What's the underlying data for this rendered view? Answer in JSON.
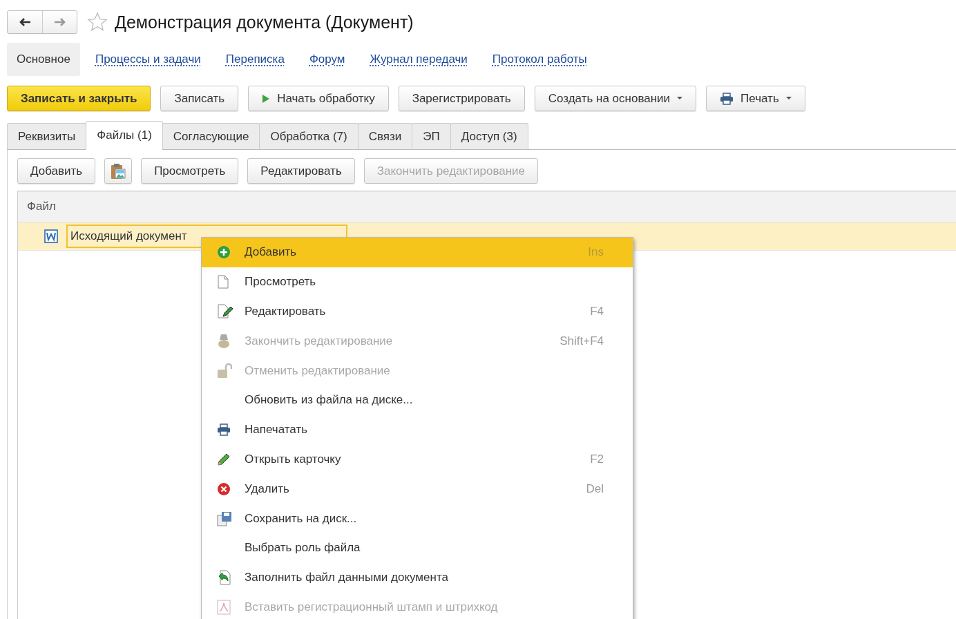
{
  "window": {
    "title": "Демонстрация документа (Документ)"
  },
  "nav_links": [
    {
      "label": "Основное",
      "selected": true
    },
    {
      "label": "Процессы и задачи",
      "selected": false
    },
    {
      "label": "Переписка",
      "selected": false
    },
    {
      "label": "Форум",
      "selected": false
    },
    {
      "label": "Журнал передачи",
      "selected": false
    },
    {
      "label": "Протокол работы",
      "selected": false
    }
  ],
  "commands": [
    {
      "label": "Записать и закрыть",
      "kind": "primary"
    },
    {
      "label": "Записать",
      "kind": "plain"
    },
    {
      "label": "Начать обработку",
      "kind": "play"
    },
    {
      "label": "Зарегистрировать",
      "kind": "plain"
    },
    {
      "label": "Создать на основании",
      "kind": "dropdown"
    },
    {
      "label": "Печать",
      "kind": "print"
    }
  ],
  "tabs": [
    {
      "label": "Реквизиты",
      "selected": false
    },
    {
      "label": "Файлы (1)",
      "selected": true
    },
    {
      "label": "Согласующие",
      "selected": false
    },
    {
      "label": "Обработка (7)",
      "selected": false
    },
    {
      "label": "Связи",
      "selected": false
    },
    {
      "label": "ЭП",
      "selected": false
    },
    {
      "label": "Доступ (3)",
      "selected": false
    }
  ],
  "files_toolbar": [
    {
      "label": "Добавить",
      "kind": "text",
      "disabled": false
    },
    {
      "kind": "paste",
      "disabled": false
    },
    {
      "label": "Просмотреть",
      "kind": "text",
      "disabled": false
    },
    {
      "label": "Редактировать",
      "kind": "text",
      "disabled": false
    },
    {
      "label": "Закончить редактирование",
      "kind": "text",
      "disabled": true
    }
  ],
  "table": {
    "columns": [
      "Файл"
    ],
    "rows": [
      {
        "file": "Исходящий документ",
        "selected": true
      }
    ]
  },
  "context_menu": {
    "items": [
      {
        "kind": "add",
        "label": "Добавить",
        "shortcut": "Ins",
        "disabled": false,
        "selected": true
      },
      {
        "kind": "view",
        "label": "Просмотреть",
        "disabled": false,
        "selected": false
      },
      {
        "kind": "edit",
        "label": "Редактировать",
        "shortcut": "F4",
        "disabled": false,
        "selected": false
      },
      {
        "kind": "finish",
        "label": "Закончить редактирование",
        "shortcut": "Shift+F4",
        "disabled": true,
        "selected": false
      },
      {
        "kind": "unlock",
        "label": "Отменить редактирование",
        "disabled": true,
        "selected": false
      },
      {
        "kind": "plain",
        "label": "Обновить из файла на диске...",
        "disabled": false,
        "selected": false
      },
      {
        "kind": "print",
        "label": "Напечатать",
        "disabled": false,
        "selected": false
      },
      {
        "kind": "card",
        "label": "Открыть карточку",
        "shortcut": "F2",
        "disabled": false,
        "selected": false
      },
      {
        "kind": "delete",
        "label": "Удалить",
        "shortcut": "Del",
        "disabled": false,
        "selected": false
      },
      {
        "kind": "save",
        "label": "Сохранить на диск...",
        "disabled": false,
        "selected": false
      },
      {
        "kind": "plain",
        "label": "Выбрать роль файла",
        "disabled": false,
        "selected": false
      },
      {
        "kind": "fill",
        "label": "Заполнить файл данными документа",
        "disabled": false,
        "selected": false
      },
      {
        "kind": "stamp",
        "label": "Вставить регистрационный штамп и штрихкод",
        "disabled": true,
        "selected": false
      }
    ]
  }
}
